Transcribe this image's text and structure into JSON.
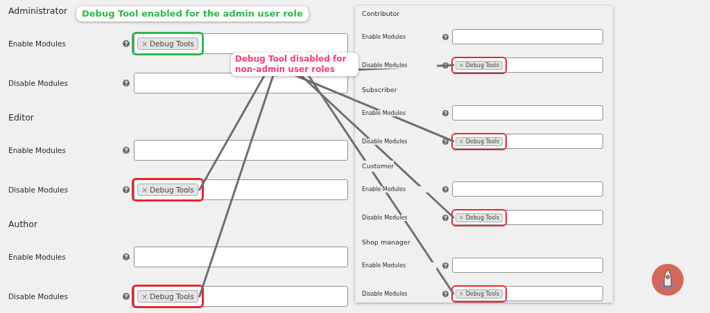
{
  "left_sections": [
    {
      "role": "Administrator",
      "fields": [
        {
          "label": "Enable Modules",
          "tags": [
            {
              "remove": "×",
              "label": "Debug Tools"
            }
          ],
          "color": "#2db84c",
          "connected": false
        },
        {
          "label": "Disable Modules"
        }
      ]
    },
    {
      "role": "Editor",
      "fields": [
        {
          "label": "Enable Modules"
        },
        {
          "label": "Disable Modules",
          "tags": [
            {
              "remove": "×",
              "label": "Debug Tools"
            }
          ],
          "color": "#e8262b",
          "connected": true
        }
      ]
    },
    {
      "role": "Author",
      "fields": [
        {
          "label": "Enable Modules"
        },
        {
          "label": "Disable Modules",
          "tags": [
            {
              "remove": "×",
              "label": "Debug Tools"
            }
          ],
          "color": "#e8262b",
          "connected": true
        }
      ]
    }
  ],
  "right_panel": {
    "sections": [
      {
        "role": "Contributor",
        "fields": [
          {
            "label": "Enable Modules"
          },
          {
            "label": "Disable Modules",
            "tags": [
              {
                "remove": "×",
                "label": "Debug Tools"
              }
            ],
            "color": "#e8262b",
            "connected": true
          }
        ]
      },
      {
        "role": "Subscriber",
        "fields": [
          {
            "label": "Enable Modules"
          },
          {
            "label": "Disable Modules",
            "tags": [
              {
                "remove": "×",
                "label": "Debug Tools"
              }
            ],
            "color": "#e8262b",
            "connected": true
          }
        ]
      },
      {
        "role": "Customer",
        "fields": [
          {
            "label": "Enable Modules"
          },
          {
            "label": "Disable Modules",
            "tags": [
              {
                "remove": "×",
                "label": "Debug Tools"
              }
            ],
            "color": "#e8262b",
            "connected": true
          }
        ]
      },
      {
        "role": "Shop manager",
        "fields": [
          {
            "label": "Enable Modules"
          },
          {
            "label": "Disable Modules",
            "tags": [
              {
                "remove": "×",
                "label": "Debug Tools"
              }
            ],
            "color": "#e8262b",
            "connected": true
          }
        ]
      }
    ]
  },
  "callouts": [
    {
      "text": "Debug Tool enabled for the admin user role",
      "color": "#2db84c",
      "lines": false
    },
    {
      "text": "Debug Tool disabled for non-admin user roles",
      "color": "#ff3b6f",
      "lines": true
    }
  ]
}
